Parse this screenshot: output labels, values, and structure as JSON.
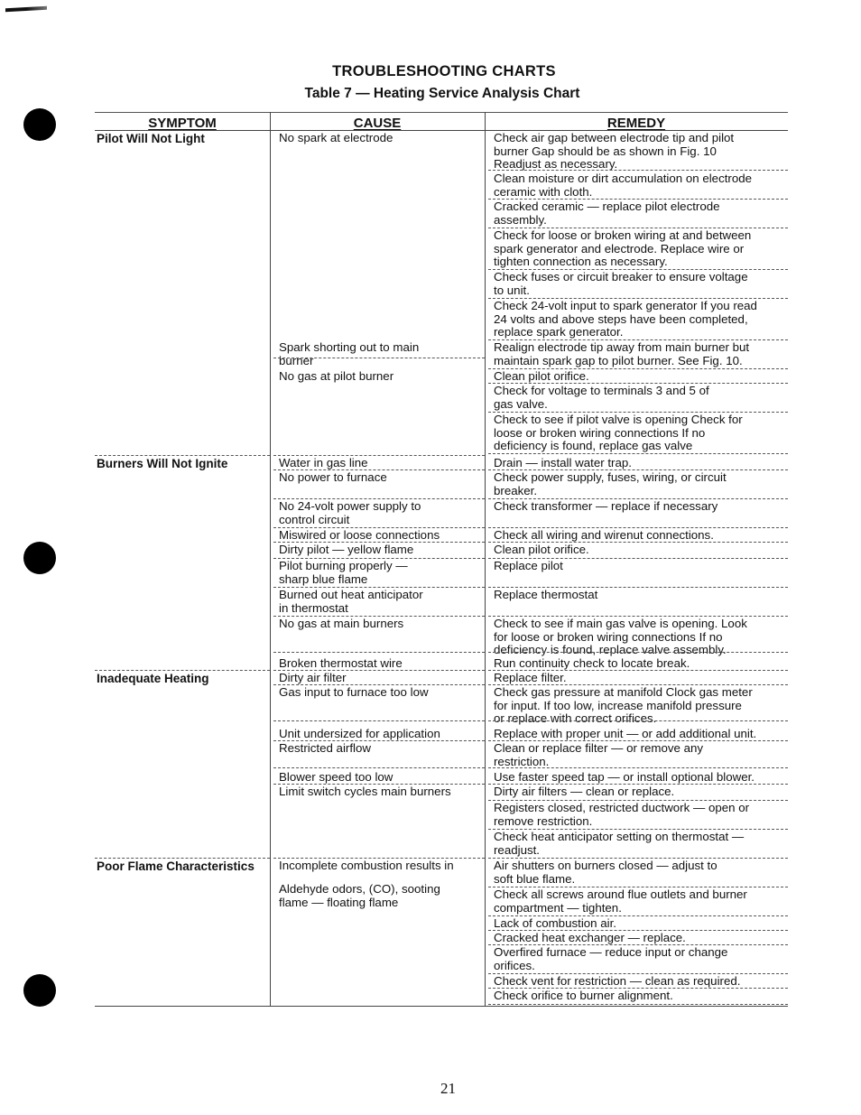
{
  "page": {
    "title": "TROUBLESHOOTING CHARTS",
    "subtitle": "Table 7 — Heating Service Analysis Chart",
    "page_number": "21"
  },
  "table": {
    "headers": {
      "symptom": "SYMPTOM",
      "cause": "CAUSE",
      "remedy": "REMEDY"
    },
    "symptoms": [
      "Pilot Will Not Light",
      "Burners Will Not Ignite",
      "Inadequate Heating",
      "Poor Flame Characteristics"
    ],
    "causes": [
      "No spark at electrode",
      "Spark shorting out to main\nburner",
      "No gas at pilot burner",
      "Water in gas line",
      "No power to furnace",
      "No 24-volt power supply to\ncontrol circuit",
      "Miswired or loose connections",
      "Dirty pilot — yellow flame",
      "Pilot burning properly —\nsharp blue flame",
      "Burned out heat anticipator\nin thermostat",
      "No gas at main burners",
      "Broken thermostat wire",
      "Dirty air filter",
      "Gas input to furnace too low",
      "Unit undersized for application",
      "Restricted airflow",
      "Blower speed too low",
      "Limit switch cycles main burners",
      "Incomplete combustion results in",
      "Aldehyde odors, (CO), sooting\nflame — floating flame"
    ],
    "remedies": [
      "Check air gap between electrode tip and pilot\nburner  Gap should be as shown in Fig. 10\nReadjust as necessary.",
      "Clean moisture or dirt accumulation on electrode\nceramic with cloth.",
      "Cracked ceramic — replace pilot electrode\nassembly.",
      "Check for loose or broken wiring at and between\nspark generator and electrode. Replace wire or\ntighten connection as necessary.",
      "Check fuses or circuit breaker to ensure voltage\nto unit.",
      "Check 24-volt input to spark generator  If you read\n24 volts and above steps have been completed,\nreplace spark generator.",
      "Realign electrode tip away from main burner but\nmaintain spark gap to pilot burner. See Fig. 10.",
      "Clean pilot orifice.",
      "Check for voltage to terminals 3 and 5 of\ngas valve.",
      "Check to see if pilot valve is opening  Check for\nloose or broken wiring connections  If no\ndeficiency is found, replace gas valve",
      "Drain — install water trap.",
      "Check power supply, fuses, wiring, or circuit\nbreaker.",
      "Check transformer — replace if necessary",
      "Check all wiring and wirenut connections.",
      "Clean pilot orifice.",
      "Replace pilot",
      "Replace thermostat",
      "Check to see if main gas valve is opening. Look\nfor loose or broken wiring connections  If no\ndeficiency is found, replace valve assembly.",
      "Run continuity check to locate break.",
      "Replace filter.",
      "Check gas pressure at manifold  Clock gas meter\nfor input. If too low, increase manifold pressure\nor replace with correct orifices.",
      "Replace with proper unit — or add additional unit.",
      "Clean or replace filter — or remove any\nrestriction.",
      "Use faster speed tap — or install optional blower.",
      "Dirty air filters — clean or replace.",
      "Registers closed, restricted ductwork — open or\nremove restriction.",
      "Check heat anticipator setting on thermostat —\nreadjust.",
      "Air shutters on burners closed — adjust to\nsoft blue flame.",
      "Check all screws around flue outlets and burner\ncompartment — tighten.",
      "Lack of combustion air.",
      "Cracked heat exchanger — replace.",
      "Overfired furnace — reduce input or change\norifices.",
      "Check vent for restriction — clean as required.",
      "Check orifice to burner alignment."
    ]
  }
}
